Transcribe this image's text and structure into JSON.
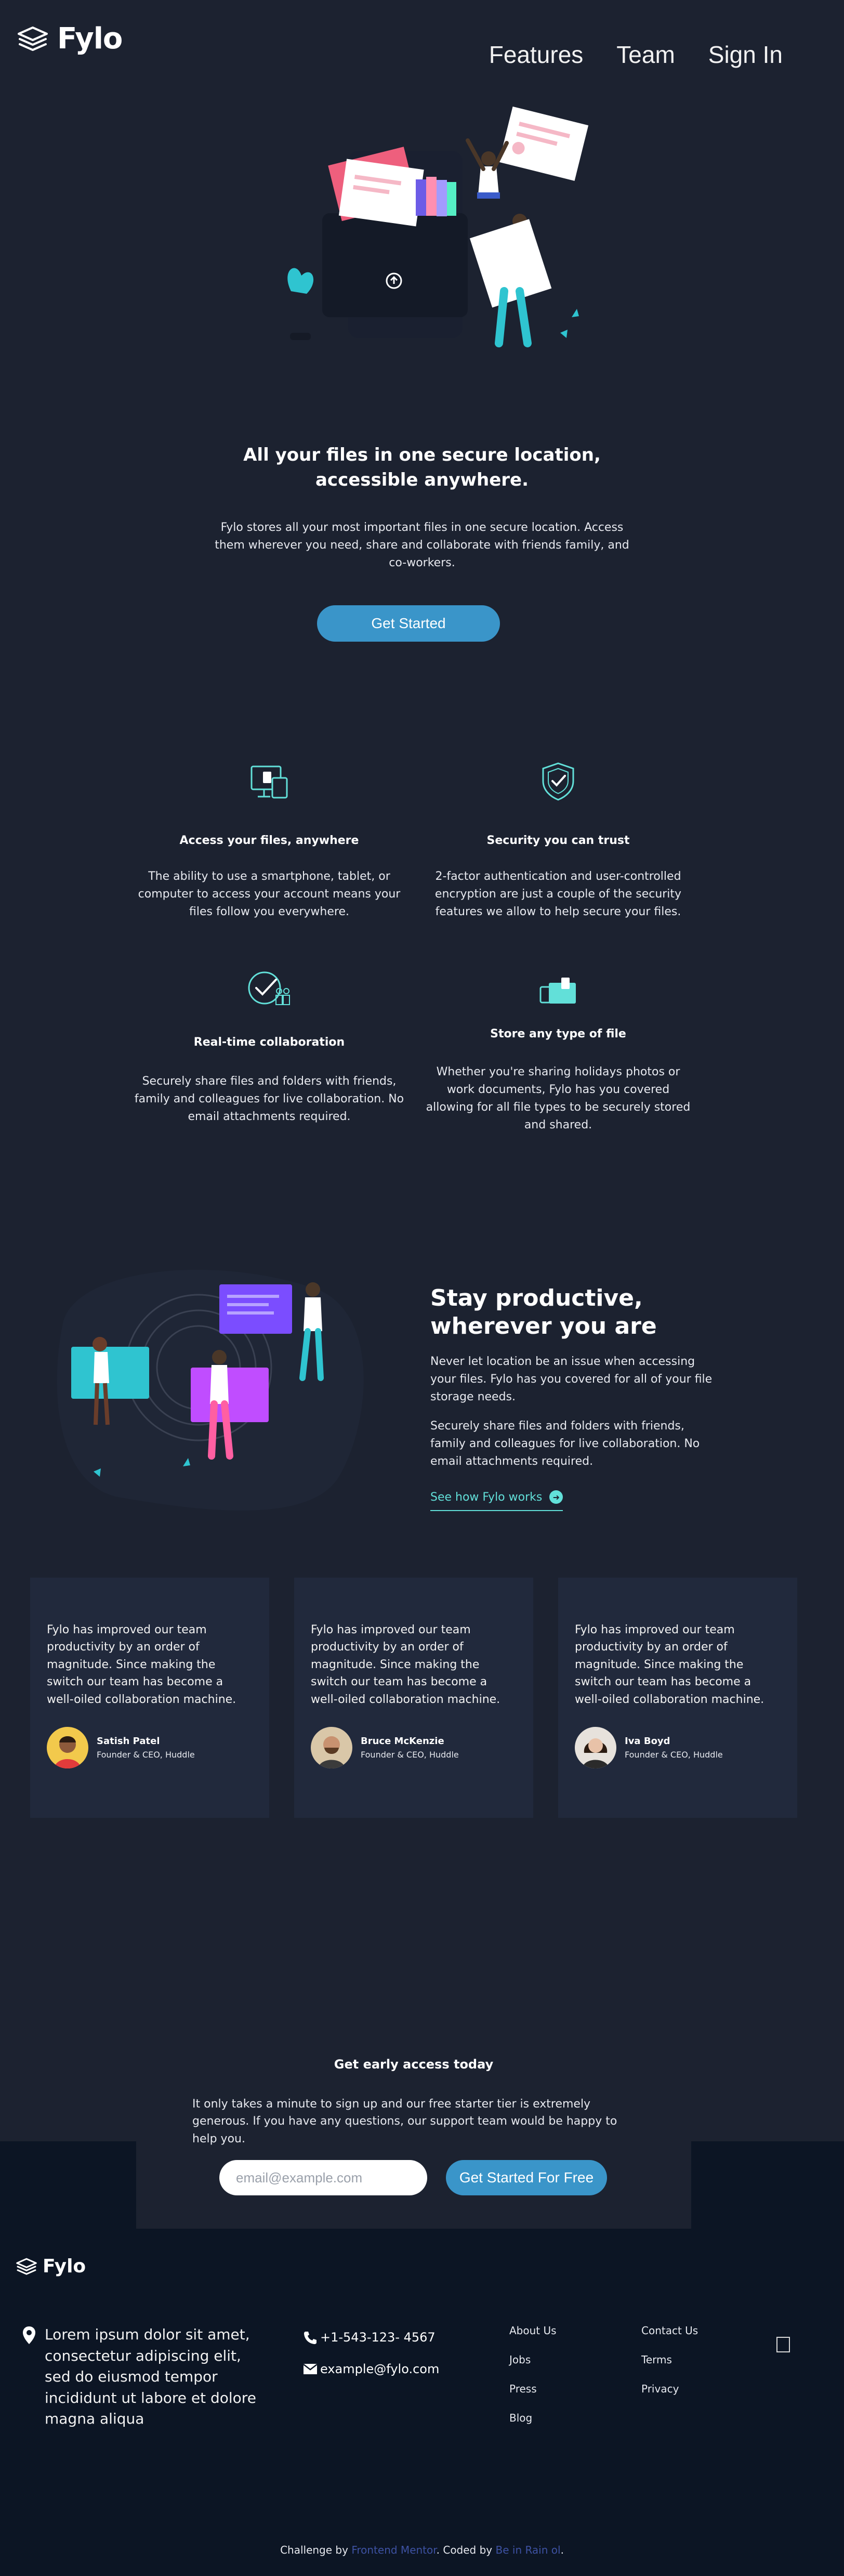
{
  "header": {
    "brand": "Fylo",
    "nav": [
      {
        "label": "Features"
      },
      {
        "label": "Team"
      },
      {
        "label": "Sign In"
      }
    ]
  },
  "hero": {
    "title": "All your files in one secure location, accessible anywhere.",
    "text": "Fylo stores all your most important files in one secure location. Access them wherever you need, share and collaborate with friends family, and co-workers.",
    "cta": "Get Started"
  },
  "features": [
    {
      "icon": "devices-icon",
      "title": "Access your files, anywhere",
      "text": "The ability to use a smartphone, tablet, or computer to access your account means your files follow you everywhere."
    },
    {
      "icon": "shield-icon",
      "title": "Security you can trust",
      "text": "2-factor authentication and user-controlled encryption are just a couple of the security features we allow to help secure your files."
    },
    {
      "icon": "collaboration-icon",
      "title": "Real-time collaboration",
      "text": "Securely share files and folders with friends, family and colleagues for live collaboration. No email attachments required."
    },
    {
      "icon": "folders-icon",
      "title": "Store any type of file",
      "text": "Whether you're sharing holidays photos or work documents, Fylo has you covered allowing for all file types to be securely stored and shared."
    }
  ],
  "productive": {
    "title": "Stay productive, wherever you are",
    "p1": "Never let location be an issue when accessing your files. Fylo has you covered for all of your file storage needs.",
    "p2": "Securely share files and folders with friends, family and colleagues for live collaboration. No email attachments required.",
    "link": "See how Fylo works"
  },
  "testimonials": [
    {
      "quote": "Fylo has improved our team productivity by an order of magnitude. Since making the switch our team has become a well-oiled collaboration machine.",
      "name": "Satish Patel",
      "role": "Founder & CEO, Huddle"
    },
    {
      "quote": "Fylo has improved our team productivity by an order of magnitude. Since making the switch our team has become a well-oiled collaboration machine.",
      "name": "Bruce McKenzie",
      "role": "Founder & CEO, Huddle"
    },
    {
      "quote": "Fylo has improved our team productivity by an order of magnitude. Since making the switch our team has become a well-oiled collaboration machine.",
      "name": "Iva Boyd",
      "role": "Founder & CEO, Huddle"
    }
  ],
  "early_access": {
    "title": "Get early access today",
    "text": "It only takes a minute to sign up and our free starter tier is extremely generous. If you have any questions, our support team would be happy to help you.",
    "placeholder": "email@example.com",
    "button": "Get Started For Free"
  },
  "footer": {
    "brand": "Fylo",
    "address": "Lorem ipsum dolor sit amet, consectetur adipiscing elit, sed do eiusmod tempor incididunt ut labore et dolore magna aliqua",
    "phone": "+1-543-123- 4567",
    "email": "example@fylo.com",
    "links_col1": [
      "About Us",
      "Jobs",
      "Press",
      "Blog"
    ],
    "links_col2": [
      "Contact Us",
      "Terms",
      "Privacy"
    ],
    "attribution": {
      "prefix": "Challenge by ",
      "fm": "Frontend Mentor",
      "middle": ". Coded by ",
      "author": "Be in Rain ol",
      "suffix": "."
    }
  },
  "colors": {
    "background": "#1c2230",
    "card": "#21293c",
    "footer": "#0c1524",
    "accent_blue": "#3a95c9",
    "accent_cyan": "#62e0d9"
  }
}
